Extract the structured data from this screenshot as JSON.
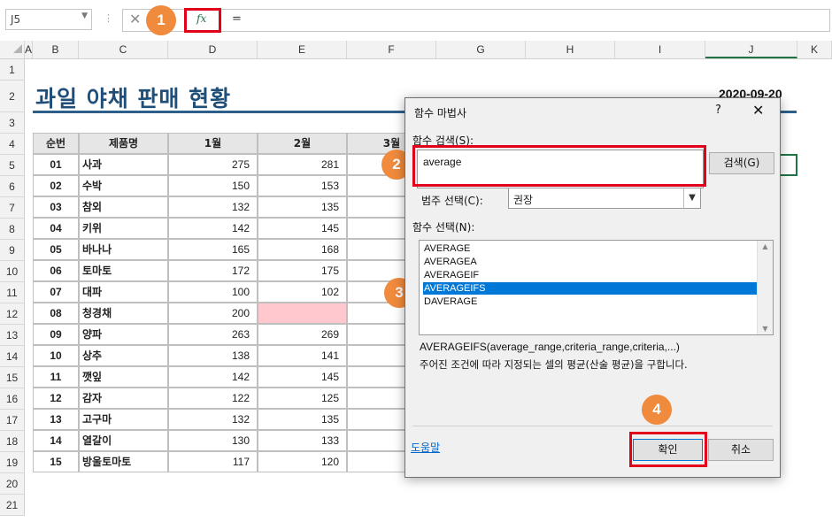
{
  "formula_bar": {
    "name_box": "J5",
    "dots": "⋮",
    "cancel_symbol": "✕",
    "fx_label": "fx",
    "formula": "="
  },
  "badges": [
    "1",
    "2",
    "3",
    "4"
  ],
  "columns": [
    "A",
    "B",
    "C",
    "D",
    "E",
    "F",
    "G",
    "H",
    "I",
    "J",
    "K"
  ],
  "rows": [
    "1",
    "2",
    "3",
    "4",
    "5",
    "6",
    "7",
    "8",
    "9",
    "10",
    "11",
    "12",
    "13",
    "14",
    "15",
    "16",
    "17",
    "18",
    "19",
    "20",
    "21"
  ],
  "sheet": {
    "title": "과일 야채 판매 현황",
    "date": "2020-09-20",
    "headers": [
      "순번",
      "제품명",
      "1월",
      "2월",
      "3월"
    ],
    "rows": [
      {
        "no": "01",
        "name": "사과",
        "m1": "275",
        "m2": "281"
      },
      {
        "no": "02",
        "name": "수박",
        "m1": "150",
        "m2": "153"
      },
      {
        "no": "03",
        "name": "참외",
        "m1": "132",
        "m2": "135"
      },
      {
        "no": "04",
        "name": "키위",
        "m1": "142",
        "m2": "145"
      },
      {
        "no": "05",
        "name": "바나나",
        "m1": "165",
        "m2": "168"
      },
      {
        "no": "06",
        "name": "토마토",
        "m1": "172",
        "m2": "175"
      },
      {
        "no": "07",
        "name": "대파",
        "m1": "100",
        "m2": "102"
      },
      {
        "no": "08",
        "name": "청경채",
        "m1": "200",
        "m2": ""
      },
      {
        "no": "09",
        "name": "양파",
        "m1": "263",
        "m2": "269"
      },
      {
        "no": "10",
        "name": "상추",
        "m1": "138",
        "m2": "141"
      },
      {
        "no": "11",
        "name": "깻잎",
        "m1": "142",
        "m2": "145"
      },
      {
        "no": "12",
        "name": "감자",
        "m1": "122",
        "m2": "125"
      },
      {
        "no": "13",
        "name": "고구마",
        "m1": "132",
        "m2": "135"
      },
      {
        "no": "14",
        "name": "열갈이",
        "m1": "130",
        "m2": "133"
      },
      {
        "no": "15",
        "name": "방울토마토",
        "m1": "117",
        "m2": "120"
      }
    ]
  },
  "dialog": {
    "title": "함수 마법사",
    "help_symbol": "?",
    "close_symbol": "✕",
    "search_label": "함수 검색(S):",
    "search_value": "average",
    "search_button": "검색(G)",
    "category_label": "범주 선택(C):",
    "category_value": "권장",
    "function_label": "함수 선택(N):",
    "functions": [
      "AVERAGE",
      "AVERAGEA",
      "AVERAGEIF",
      "AVERAGEIFS",
      "DAVERAGE"
    ],
    "selected_index": 3,
    "syntax": "AVERAGEIFS(average_range,criteria_range,criteria,...)",
    "description": "주어진 조건에 따라 지정되는 셀의 평균(산술 평균)을 구합니다.",
    "help_link": "도움말",
    "ok_button": "확인",
    "cancel_button": "취소"
  },
  "colors": {
    "accent_red": "#e2001a",
    "badge_orange": "#f08a3c",
    "title_blue": "#1f4e79",
    "selection_blue": "#0078d7",
    "empty_cell_pink": "#ffc7ce"
  }
}
